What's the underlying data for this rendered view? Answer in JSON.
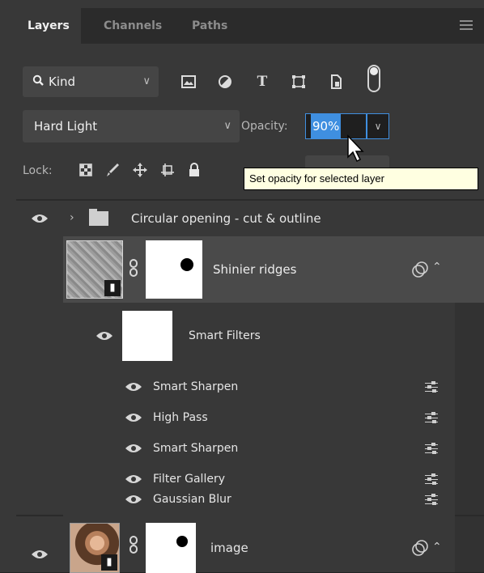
{
  "tabs": [
    {
      "label": "Layers",
      "active": true
    },
    {
      "label": "Channels",
      "active": false
    },
    {
      "label": "Paths",
      "active": false
    }
  ],
  "filter": {
    "kind_label": "Kind",
    "icons": [
      "image-filter-icon",
      "adjustment-filter-icon",
      "type-filter-icon",
      "shape-filter-icon",
      "smart-object-filter-icon"
    ]
  },
  "blend": {
    "mode": "Hard Light",
    "opacity_label": "Opacity:",
    "opacity_value": "90%"
  },
  "lock": {
    "label": "Lock:"
  },
  "tooltip": "Set opacity for selected layer",
  "layers": {
    "group": {
      "name": "Circular opening - cut & outline"
    },
    "selected": {
      "name": "Shinier ridges"
    },
    "smart_filters": {
      "label": "Smart Filters",
      "items": [
        "Smart Sharpen",
        "High Pass",
        "Smart Sharpen",
        "Filter Gallery",
        "Gaussian Blur"
      ]
    },
    "image": {
      "name": "image"
    }
  },
  "colors": {
    "panel": "#383838",
    "tab_bar": "#2b2b2b",
    "selected_row": "#4a4a4a",
    "accent": "#3f8fe0",
    "tooltip_bg": "#ffffe1"
  }
}
